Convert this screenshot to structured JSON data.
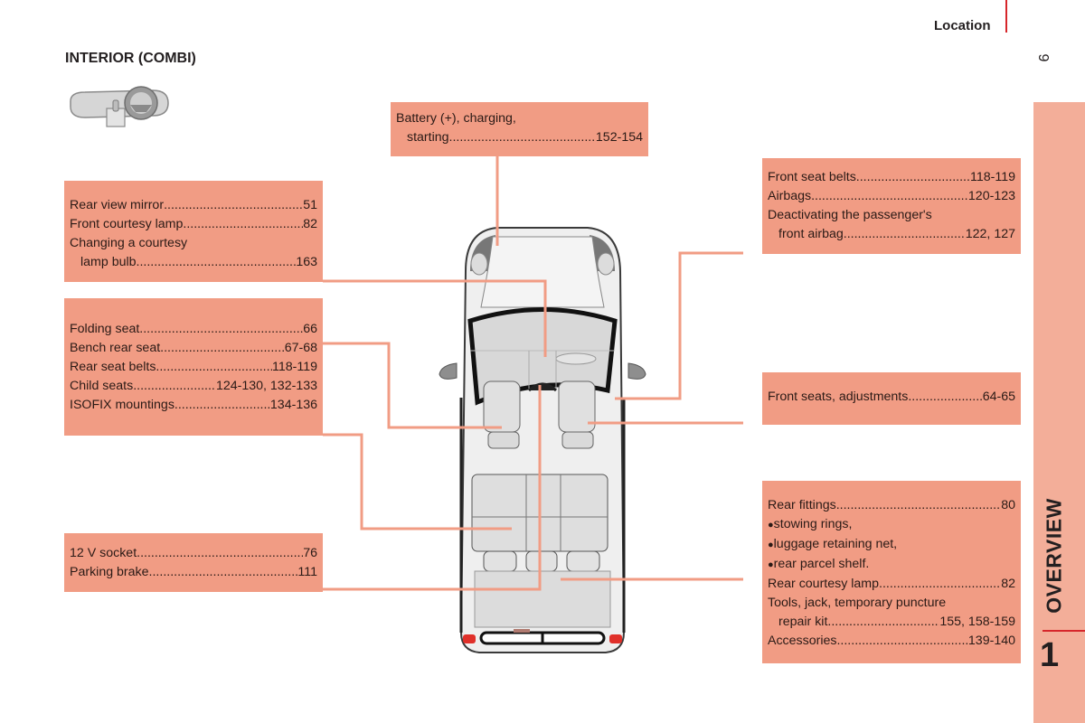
{
  "header": {
    "section": "Location",
    "page_number": "9"
  },
  "sidebar": {
    "chapter_title": "OVERVIEW",
    "chapter_number": "1",
    "tab_color": "#f3ae99",
    "accent": "#d6262b"
  },
  "page_title": "INTERIOR (COMBI)",
  "callout_color": "#f19c84",
  "callouts": {
    "battery": {
      "lines": [
        {
          "label": "Battery (+), charging,",
          "page": ""
        },
        {
          "label": "starting",
          "page": "152-154",
          "indent": true
        }
      ]
    },
    "mirror": {
      "lines": [
        {
          "label": "Rear view mirror ",
          "page": "51"
        },
        {
          "label": "Front courtesy lamp",
          "page": "82"
        },
        {
          "label": "Changing a courtesy",
          "page": ""
        },
        {
          "label": "lamp bulb ",
          "page": "163",
          "indent": true
        }
      ]
    },
    "seats_rear": {
      "lines": [
        {
          "label": "Folding seat",
          "page": "66"
        },
        {
          "label": "Bench rear seat ",
          "page": "67-68"
        },
        {
          "label": "Rear seat belts ",
          "page": " 118-119"
        },
        {
          "label": "Child seats",
          "page": " 124-130, 132-133"
        },
        {
          "label": "ISOFIX mountings ",
          "page": "134-136"
        }
      ]
    },
    "socket": {
      "lines": [
        {
          "label": "12 V socket",
          "page": "76"
        },
        {
          "label": "Parking brake ",
          "page": " 111"
        }
      ]
    },
    "belts": {
      "lines": [
        {
          "label": "Front seat belts",
          "page": " 118-119"
        },
        {
          "label": "Airbags ",
          "page": "120-123"
        },
        {
          "label": "Deactivating the passenger's",
          "page": ""
        },
        {
          "label": "front airbag ",
          "page": "122, 127",
          "indent": true
        }
      ]
    },
    "front_seats": {
      "lines": [
        {
          "label": "Front seats, adjustments ",
          "page": "64-65"
        }
      ]
    },
    "rear_fittings": {
      "lines": [
        {
          "label": "Rear fittings ",
          "page": "80"
        },
        {
          "label": "stowing rings,",
          "page": "",
          "bullet": true
        },
        {
          "label": "luggage retaining net,",
          "page": "",
          "bullet": true
        },
        {
          "label": "rear parcel shelf.",
          "page": "",
          "bullet": true
        },
        {
          "label": "Rear courtesy lamp ",
          "page": "82"
        },
        {
          "label": "Tools, jack, temporary puncture",
          "page": ""
        },
        {
          "label": "repair kit",
          "page": "155, 158-159",
          "indent": true
        },
        {
          "label": "Accessories ",
          "page": "139-140"
        }
      ]
    }
  },
  "icons": {
    "dashboard": "dashboard-overview-icon",
    "vehicle": "vehicle-top-view-illustration"
  }
}
